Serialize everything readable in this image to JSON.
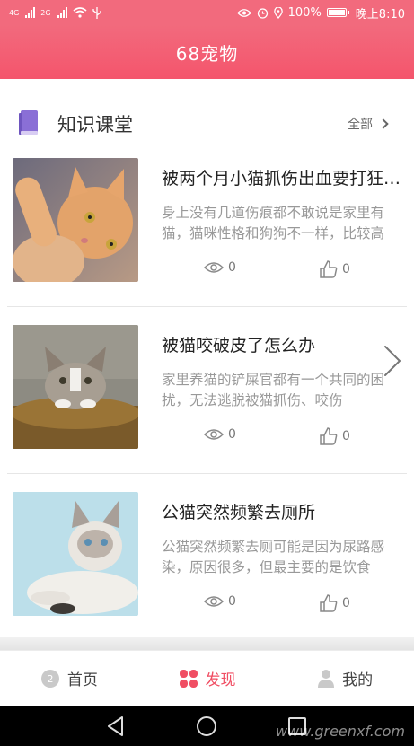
{
  "status_bar": {
    "sim1": "4G",
    "sim2": "2G",
    "battery": "100%",
    "time": "晚上8:10"
  },
  "app": {
    "title": "68宠物"
  },
  "section": {
    "icon": "book-icon",
    "title": "知识课堂",
    "more_label": "全部"
  },
  "articles": [
    {
      "title": "被两个月小猫抓伤出血要打狂犬疫苗吗",
      "desc": "身上没有几道伤痕都不敢说是家里有猫，猫咪性格和狗狗不一样，比较高冷",
      "views": "0",
      "likes": "0"
    },
    {
      "title": "被猫咬破皮了怎么办",
      "desc": "家里养猫的铲屎官都有一个共同的困扰，无法逃脱被猫抓伤、咬伤",
      "views": "0",
      "likes": "0"
    },
    {
      "title": "公猫突然频繁去厕所",
      "desc": "公猫突然频繁去厕可能是因为尿路感染，原因很多，但最主要的是饮食",
      "views": "0",
      "likes": "0"
    }
  ],
  "tabs": [
    {
      "label": "首页",
      "icon": "home-icon"
    },
    {
      "label": "发现",
      "icon": "discover-icon"
    },
    {
      "label": "我的",
      "icon": "profile-icon"
    }
  ],
  "watermark": "www.greenxf.com",
  "colors": {
    "brand": "#f26a7d",
    "active_tab": "#f04e63",
    "section_icon": "#8a6fd6"
  }
}
